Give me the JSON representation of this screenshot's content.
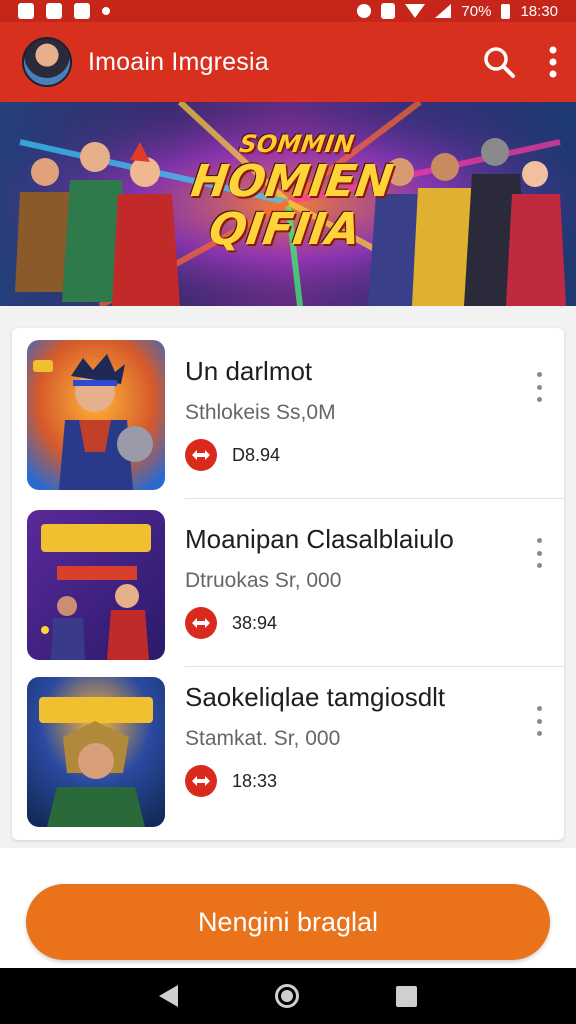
{
  "status_bar": {
    "battery": "70%",
    "time": "18:30"
  },
  "app_bar": {
    "title": "Imoain Imgresia"
  },
  "banner": {
    "line1": "SOMMIN",
    "line2": "HOMIEN",
    "line3": "QIFIIA"
  },
  "list": {
    "items": [
      {
        "title": "Un darlmot",
        "subtitle": "Sthlokeis Ss,0M",
        "meta": "D8.94",
        "thumb_icon": "hero-thumbnail-icon"
      },
      {
        "title": "Moanipan Clasalblaiulo",
        "subtitle": "Dtruokas Sr, 000",
        "meta": "38:94",
        "thumb_icon": "team-thumbnail-icon"
      },
      {
        "title": "Saokeliqlae tamgiosdlt",
        "subtitle": "Stamkat. Sr, 000",
        "meta": "18:33",
        "thumb_icon": "warrior-thumbnail-icon"
      }
    ]
  },
  "cta": {
    "label": "Nengini braglal"
  },
  "colors": {
    "app_bar": "#d8301f",
    "status_bar": "#c6261a",
    "cta": "#ea721a",
    "badge": "#d92a1d"
  }
}
